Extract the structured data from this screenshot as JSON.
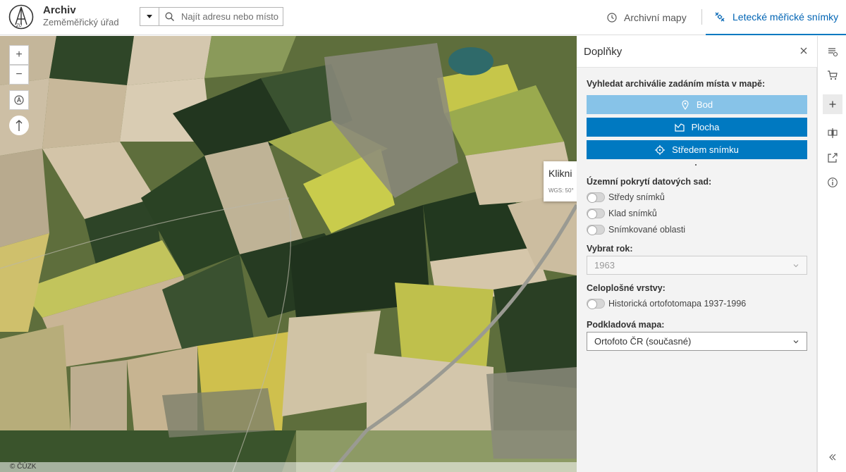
{
  "header": {
    "app_title": "Archiv",
    "app_subtitle": "Zeměměřický úřad",
    "search_placeholder": "Najít adresu nebo místo",
    "tabs": [
      {
        "label": "Archivní mapy",
        "icon": "clock-icon"
      },
      {
        "label": "Letecké měřické snímky",
        "icon": "satellite-icon",
        "active": true
      }
    ]
  },
  "map": {
    "controls": [
      "zoom-in",
      "zoom-out",
      "locate",
      "compass"
    ],
    "popup_title": "Klikni",
    "popup_coords": "WGS: 50°",
    "attribution": "© ČÚZK"
  },
  "panel": {
    "title": "Doplňky",
    "search_section_label": "Vyhledat archiválie zadáním místa v mapě:",
    "buttons": [
      {
        "label": "Bod",
        "icon": "pin-icon"
      },
      {
        "label": "Plocha",
        "icon": "polygon-icon"
      },
      {
        "label": "Středem snímku",
        "icon": "crosshair-icon"
      }
    ],
    "coverage_label": "Územní pokrytí datových sad:",
    "coverage_toggles": [
      "Středy snímků",
      "Klad snímků",
      "Snímkované oblasti"
    ],
    "year_label": "Vybrat rok:",
    "year_value": "1963",
    "layers_label": "Celoplošné vrstvy:",
    "layers_toggles": [
      "Historická ortofotomapa 1937-1996"
    ],
    "basemap_label": "Podkladová mapa:",
    "basemap_value": "Ortofoto ČR (současné)"
  },
  "rail": {
    "icons": [
      "layers-icon",
      "cart-icon",
      "plus-icon",
      "compare-icon",
      "share-icon",
      "info-icon",
      "collapse-icon"
    ]
  },
  "colors": {
    "accent": "#0079c1",
    "accent_light": "#87c3e8",
    "panel_bg": "#f3f3f3"
  }
}
